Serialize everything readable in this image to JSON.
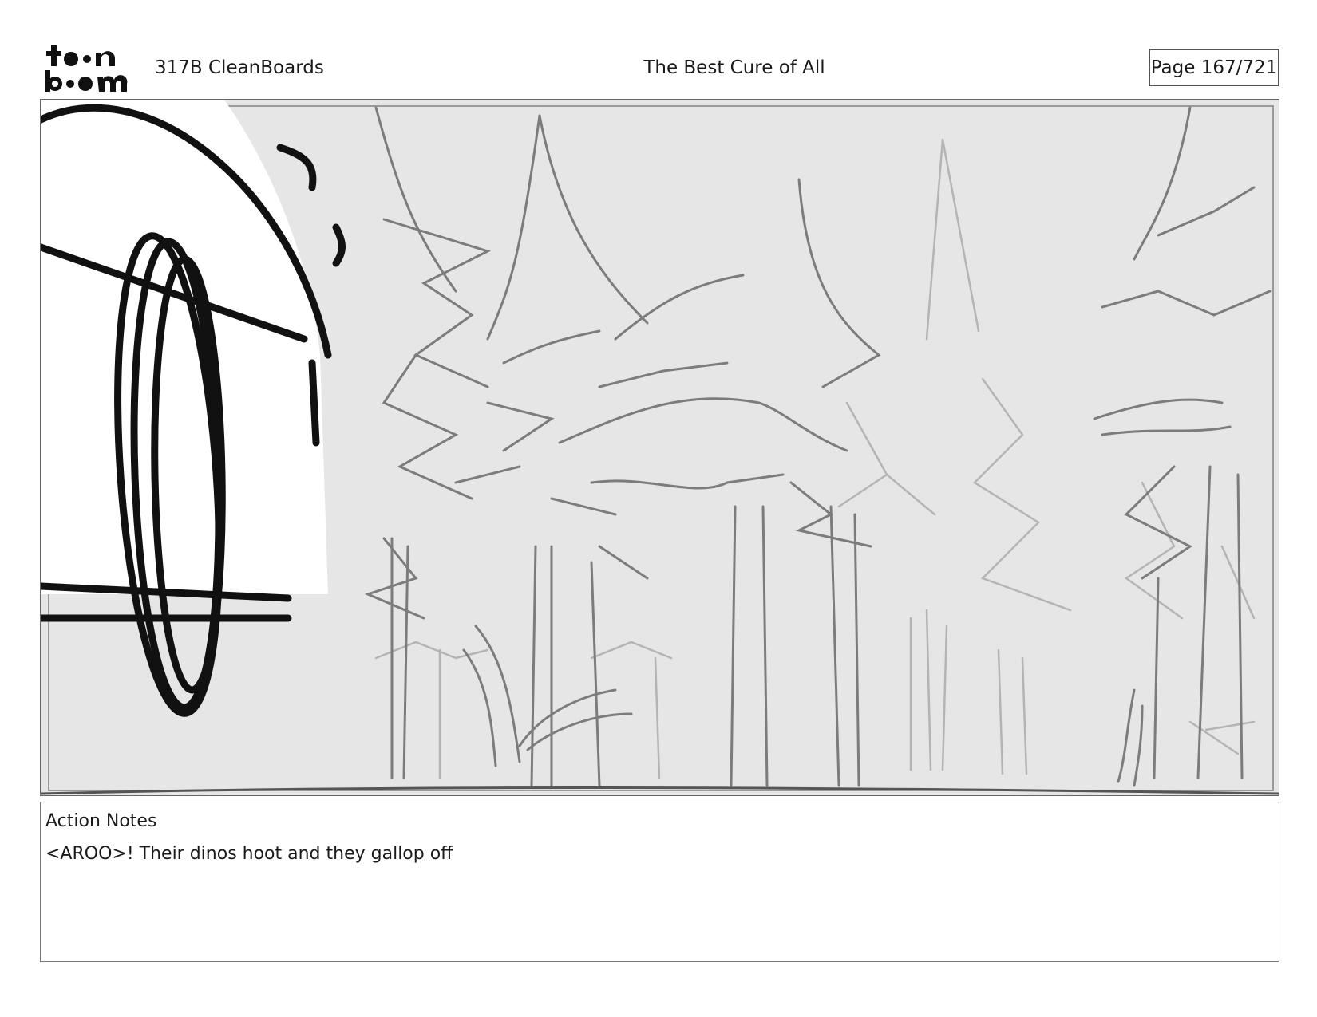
{
  "header": {
    "logo_text": "toonboom",
    "episode": "317B  CleanBoards",
    "title": "The Best Cure of All",
    "page": "Page 167/721"
  },
  "panel": {
    "image_icon": "storyboard-sketch-forest"
  },
  "notes": {
    "label": "Action Notes",
    "text": "<AROO>! Their dinos hoot and they gallop off"
  }
}
